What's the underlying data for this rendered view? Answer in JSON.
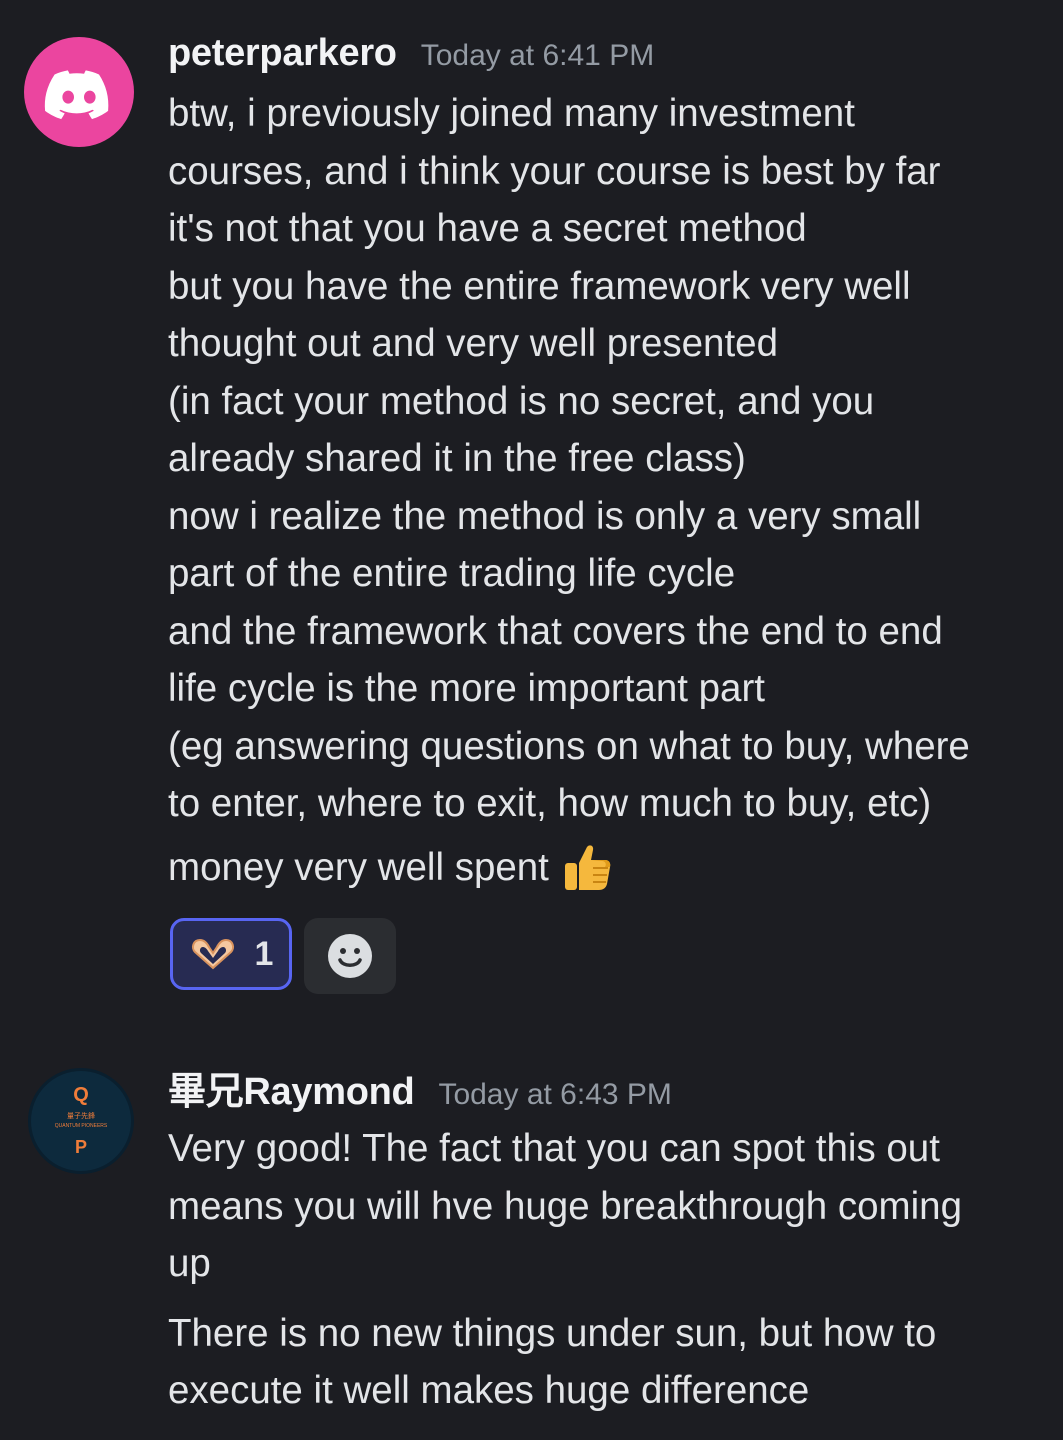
{
  "messages": [
    {
      "author": "peterparkero",
      "timestamp": "Today at 6:41 PM",
      "avatar": "discord-logo",
      "avatar_color": "#eb459f",
      "lines": [
        "btw, i previously joined many investment",
        "courses, and i think your course is best by far",
        "it's not that you have a secret method",
        "but you have the entire framework very well",
        "thought out and very well presented",
        "(in fact your method is no secret, and you",
        "already shared it in the free class)",
        "now i realize the method is only a very small",
        "part of the entire trading life cycle",
        "and the framework that covers the end to end",
        "life cycle is the more important part",
        "(eg answering questions on what to buy, where",
        "to enter, where to exit, how much to buy, etc)",
        "money very well spent"
      ],
      "end_emoji": "thumbs-up",
      "reactions": [
        {
          "emoji": "heart-hands",
          "count": "1",
          "active": true
        }
      ],
      "add_reaction_icon": "smiley-face-icon"
    },
    {
      "author": "畢兄Raymond",
      "timestamp": "Today at 6:43 PM",
      "avatar": "quantum-pioneers-logo",
      "avatar_logo_text": {
        "top": "Q",
        "middle_cn": "量子先鋒",
        "middle": "QUANTUM PIONEERS",
        "bottom": "P"
      },
      "paragraphs": [
        [
          "Very good! The fact that you can spot this out",
          "means you will hve huge breakthrough coming",
          "up"
        ],
        [
          "There is no new things under sun, but how to",
          "execute it well makes huge difference"
        ]
      ]
    }
  ],
  "colors": {
    "background": "#1c1d22",
    "text": "#e3e5e8",
    "username": "#f2f3f5",
    "timestamp": "#949ba4",
    "reaction_bg": "#272b52",
    "reaction_border": "#5865f2",
    "add_reaction_bg": "#2b2d31"
  }
}
